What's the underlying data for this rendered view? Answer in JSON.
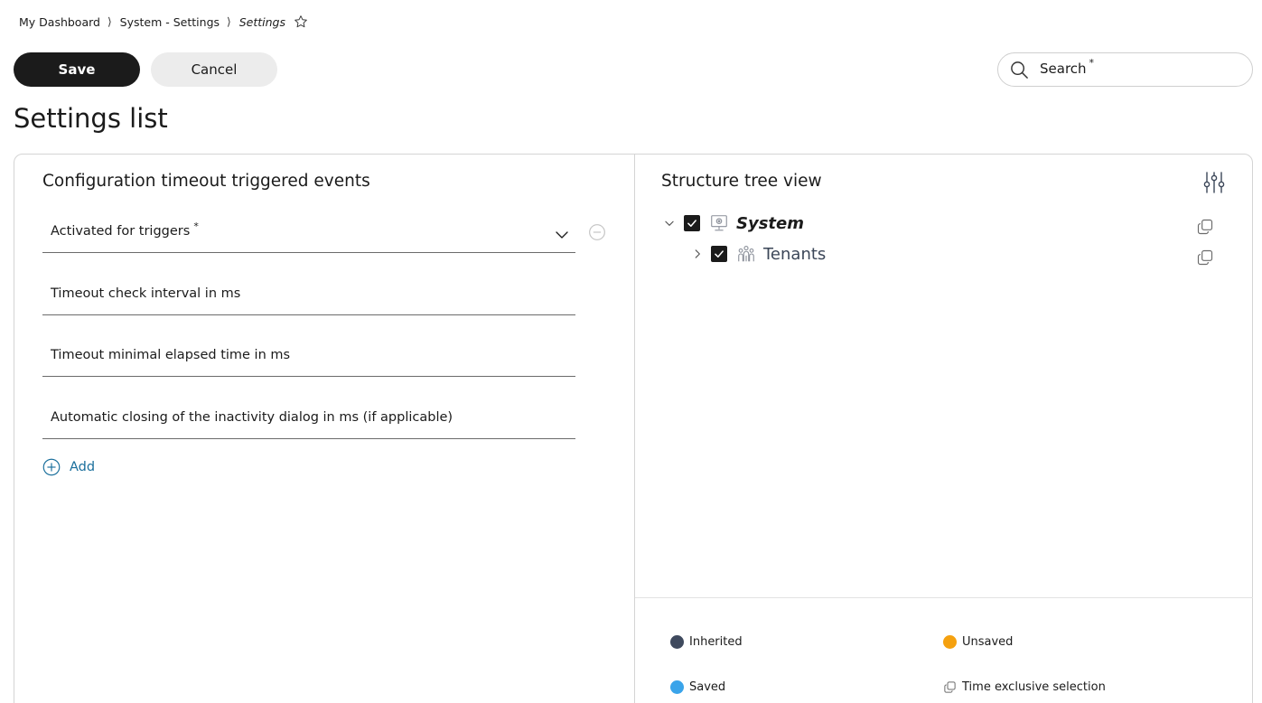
{
  "breadcrumb": {
    "items": [
      "My Dashboard",
      "System - Settings"
    ],
    "current": "Settings",
    "separator": "⟩"
  },
  "toolbar": {
    "save_label": "Save",
    "cancel_label": "Cancel"
  },
  "search": {
    "label": "Search",
    "required_mark": "*"
  },
  "page": {
    "title": "Settings list"
  },
  "left_panel": {
    "title": "Configuration timeout triggered events",
    "fields": [
      {
        "label": "Activated for triggers",
        "required_mark": "*",
        "type": "dropdown"
      },
      {
        "label": "Timeout check interval in ms"
      },
      {
        "label": "Timeout minimal elapsed time in ms"
      },
      {
        "label": "Automatic closing of the inactivity dialog in ms (if applicable)"
      }
    ],
    "add_label": "Add"
  },
  "right_panel": {
    "title": "Structure tree view",
    "tree": [
      {
        "label": "System",
        "checked": true,
        "expanded": true,
        "icon": "monitor-settings-icon"
      },
      {
        "label": "Tenants",
        "checked": true,
        "expanded": false,
        "icon": "people-group-icon"
      }
    ],
    "legend": [
      {
        "label": "Inherited",
        "color": "#3f4a5e"
      },
      {
        "label": "Unsaved",
        "color": "#f5a10f"
      },
      {
        "label": "Saved",
        "color": "#3aa4ea"
      },
      {
        "label": "Time exclusive selection",
        "icon": "copy-icon"
      }
    ]
  },
  "colors": {
    "primary_button": "#1b1b1b",
    "secondary_button": "#ececec",
    "link": "#1a6f9c"
  }
}
